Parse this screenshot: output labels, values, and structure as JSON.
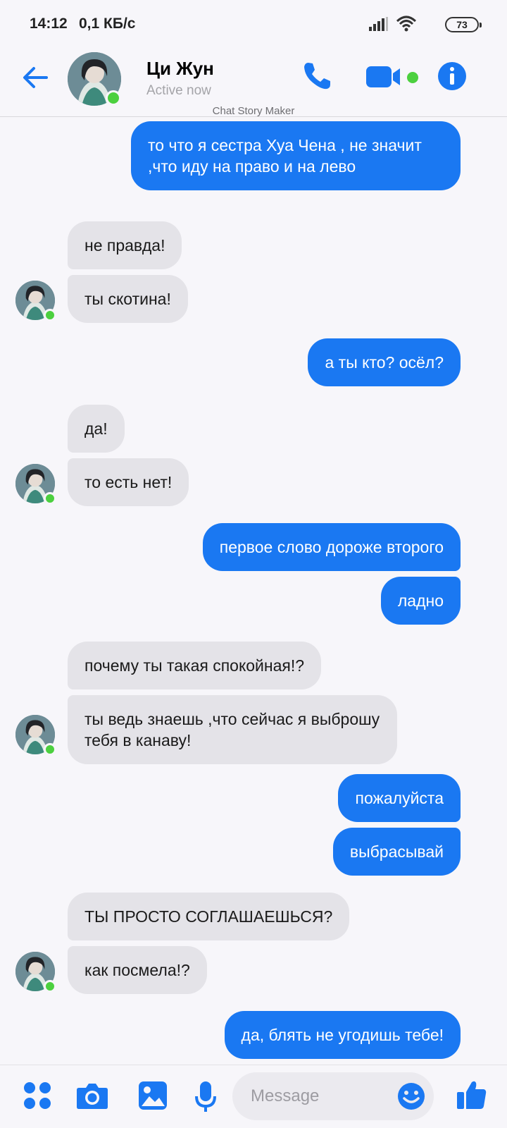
{
  "status_bar": {
    "time": "14:12",
    "network_speed": "0,1 КБ/с",
    "battery": "73"
  },
  "header": {
    "contact_name": "Ци Жун",
    "contact_status": "Active now"
  },
  "watermark": "Chat Story Maker",
  "messages": [
    {
      "side": "out",
      "text": "то что я сестра Хуа Чена , не значит ,что иду на право и на лево"
    },
    {
      "side": "in",
      "text": "не правда!"
    },
    {
      "side": "in",
      "text": "ты скотина!"
    },
    {
      "side": "out",
      "text": "а ты кто? осёл?"
    },
    {
      "side": "in",
      "text": "да!"
    },
    {
      "side": "in",
      "text": "то есть нет!"
    },
    {
      "side": "out",
      "text": "первое слово дороже второго"
    },
    {
      "side": "out",
      "text": "ладно"
    },
    {
      "side": "in",
      "text": "почему ты такая спокойная!?"
    },
    {
      "side": "in",
      "text": "ты ведь знаешь ,что сейчас я выброшу тебя в канаву!"
    },
    {
      "side": "out",
      "text": "пожалуйста"
    },
    {
      "side": "out",
      "text": "выбрасывай"
    },
    {
      "side": "in",
      "text": "ТЫ ПРОСТО СОГЛАШАЕШЬСЯ?"
    },
    {
      "side": "in",
      "text": "как посмела!?"
    },
    {
      "side": "out",
      "text": "да, блять не угодишь тебе!"
    }
  ],
  "composer": {
    "placeholder": "Message"
  },
  "colors": {
    "accent": "#1a78f2",
    "incoming_bubble": "#e4e3e8",
    "online": "#4cd03f",
    "background": "#f7f6fa"
  },
  "icons": {
    "back": "back-arrow-icon",
    "call": "phone-icon",
    "video": "video-camera-icon",
    "info": "info-icon",
    "menu": "four-dots-icon",
    "camera": "camera-icon",
    "gallery": "image-icon",
    "mic": "microphone-icon",
    "emoji": "smiley-icon",
    "like": "thumbs-up-icon"
  }
}
